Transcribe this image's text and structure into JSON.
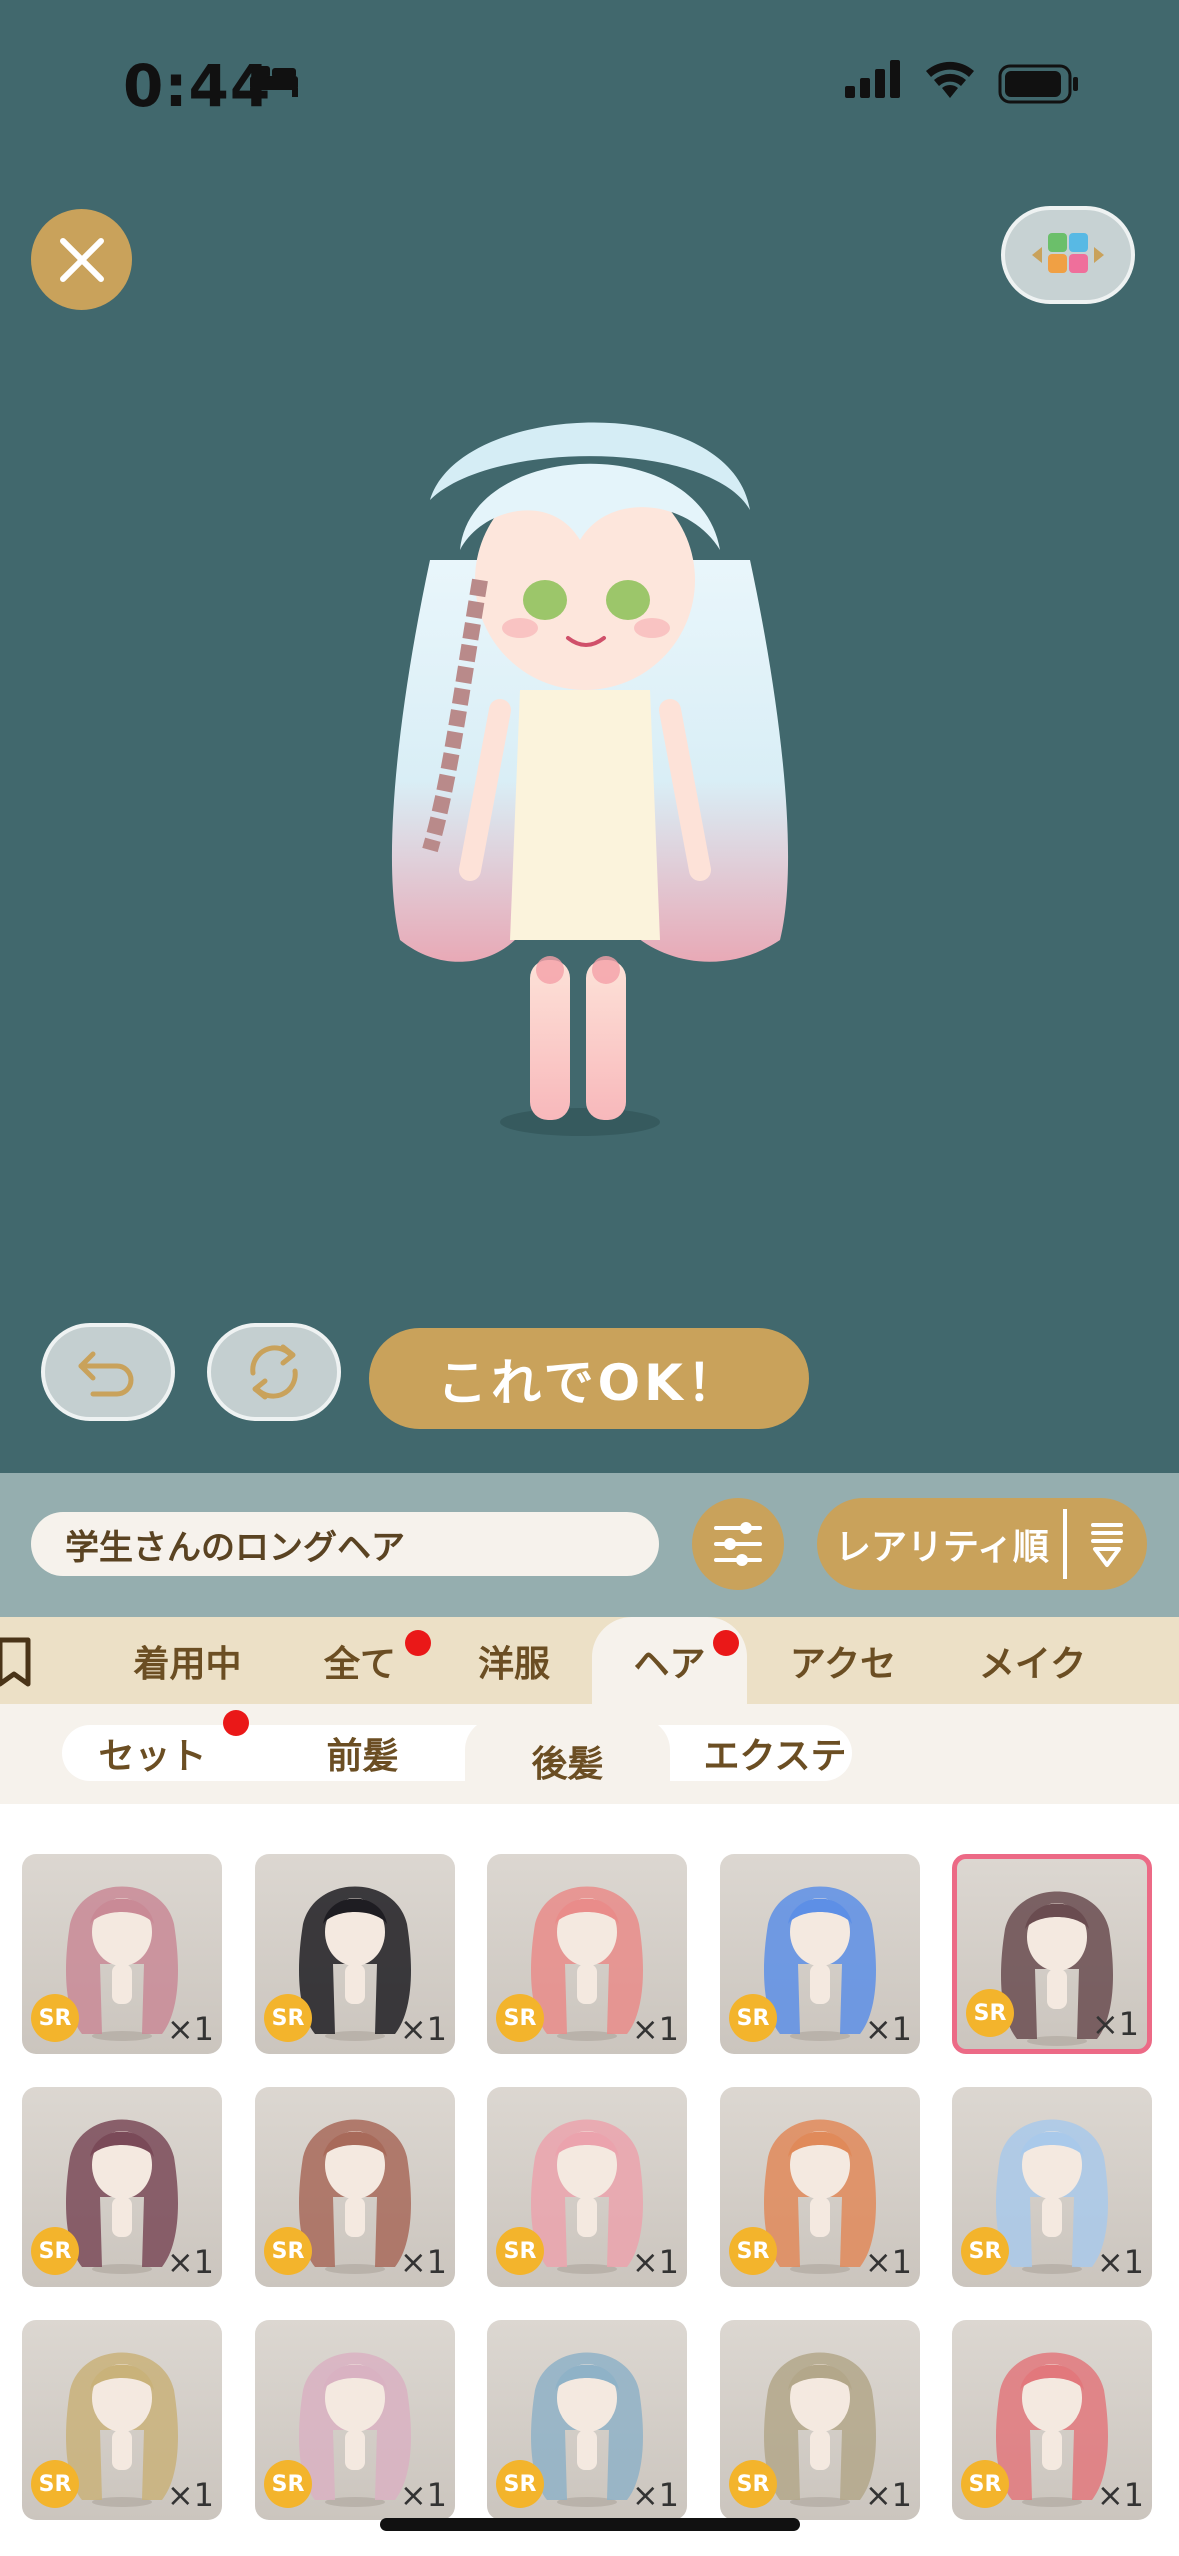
{
  "status_bar": {
    "time": "0:44"
  },
  "stage": {
    "ok_button": "これでOK！"
  },
  "toolbar": {
    "item_name": "学生さんのロングヘア",
    "sort_label": "レアリティ順"
  },
  "categories": [
    "着用中",
    "全て",
    "洋服",
    "ヘア",
    "アクセ",
    "メイク"
  ],
  "subcategories": [
    "セット",
    "前髪",
    "後髪",
    "エクステ"
  ],
  "items": [
    {
      "rarity": "SR",
      "qty": "×1",
      "hair": "#c98a96"
    },
    {
      "rarity": "SR",
      "qty": "×1",
      "hair": "#1e1d22"
    },
    {
      "rarity": "SR",
      "qty": "×1",
      "hair": "#e98c8a"
    },
    {
      "rarity": "SR",
      "qty": "×1",
      "hair": "#5d8fe6"
    },
    {
      "rarity": "SR",
      "qty": "×1",
      "hair": "#6a4c50"
    },
    {
      "rarity": "SR",
      "qty": "×1",
      "hair": "#7a4a58"
    },
    {
      "rarity": "SR",
      "qty": "×1",
      "hair": "#a86a5a"
    },
    {
      "rarity": "SR",
      "qty": "×1",
      "hair": "#eba3ad"
    },
    {
      "rarity": "SR",
      "qty": "×1",
      "hair": "#e08a5a"
    },
    {
      "rarity": "SR",
      "qty": "×1",
      "hair": "#a9c9ea"
    },
    {
      "rarity": "SR",
      "qty": "×1",
      "hair": "#c9b27a"
    },
    {
      "rarity": "SR",
      "qty": "×1",
      "hair": "#d9b2c2"
    },
    {
      "rarity": "SR",
      "qty": "×1",
      "hair": "#8fb2c7"
    },
    {
      "rarity": "SR",
      "qty": "×1",
      "hair": "#b3a78a"
    },
    {
      "rarity": "SR",
      "qty": "×1",
      "hair": "#e2787c"
    }
  ],
  "colors": {
    "accent": "#c9a25b",
    "stage_bg": "#41686d",
    "notify": "#ea1818",
    "selected": "#ec6a86"
  }
}
